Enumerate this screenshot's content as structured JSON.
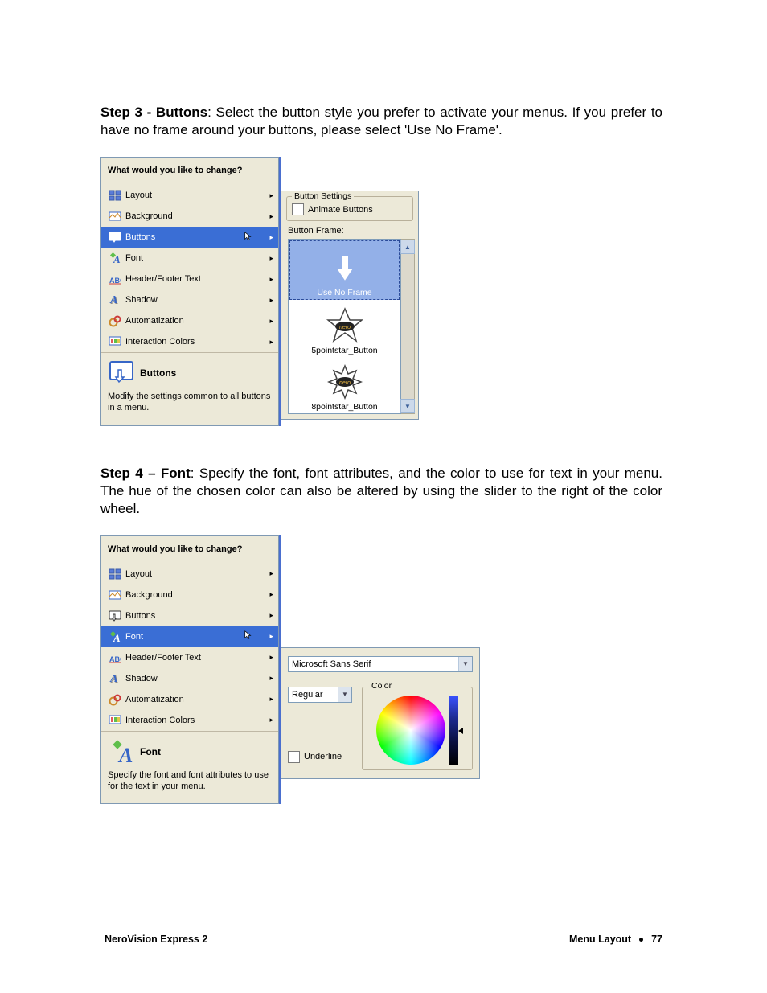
{
  "step3": {
    "heading_strong": "Step 3 - Buttons",
    "text_after": ": Select the button style you prefer to activate your menus. If you prefer to have no frame around your buttons, please select 'Use No Frame'."
  },
  "step4": {
    "heading_strong": "Step 4 – Font",
    "text_after": ": Specify the font, font attributes, and the color to use for text in your menu. The hue of the chosen color can also be altered by using the slider to the right of the color wheel."
  },
  "menu1": {
    "heading": "What would you like to change?",
    "items": [
      {
        "label": "Layout",
        "selected": false
      },
      {
        "label": "Background",
        "selected": false
      },
      {
        "label": "Buttons",
        "selected": true
      },
      {
        "label": "Font",
        "selected": false
      },
      {
        "label": "Header/Footer Text",
        "selected": false
      },
      {
        "label": "Shadow",
        "selected": false
      },
      {
        "label": "Automatization",
        "selected": false
      },
      {
        "label": "Interaction Colors",
        "selected": false
      }
    ],
    "info_title": "Buttons",
    "info_desc": "Modify the settings common to all buttons in a menu."
  },
  "buttons_panel": {
    "groupbox_title": "Button Settings",
    "animate_label": "Animate Buttons",
    "frame_label": "Button Frame:",
    "frame_items": [
      {
        "caption": "Use No Frame",
        "selected": true
      },
      {
        "caption": "5pointstar_Button",
        "selected": false
      },
      {
        "caption": "8pointstar_Button",
        "selected": false
      }
    ]
  },
  "menu2": {
    "heading": "What would you like to change?",
    "items": [
      {
        "label": "Layout",
        "selected": false
      },
      {
        "label": "Background",
        "selected": false
      },
      {
        "label": "Buttons",
        "selected": false
      },
      {
        "label": "Font",
        "selected": true
      },
      {
        "label": "Header/Footer Text",
        "selected": false
      },
      {
        "label": "Shadow",
        "selected": false
      },
      {
        "label": "Automatization",
        "selected": false
      },
      {
        "label": "Interaction Colors",
        "selected": false
      }
    ],
    "info_title": "Font",
    "info_desc": "Specify the font and font attributes to use for the text in your menu."
  },
  "font_panel": {
    "font_name": "Microsoft Sans Serif",
    "style": "Regular",
    "color_group": "Color",
    "underline": "Underline"
  },
  "footer": {
    "left": "NeroVision Express 2",
    "section": "Menu Layout",
    "page": "77"
  }
}
